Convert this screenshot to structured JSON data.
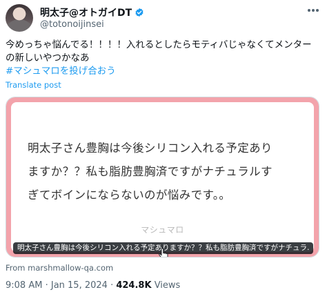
{
  "author": {
    "display_name": "明太子@オトガイDT",
    "handle": "@totonoijinsei"
  },
  "post": {
    "text": "今めっちゃ悩んでる！！！！入れるとしたらモティバじゃなくてメンター",
    "text_line2": "の新しいやつかなあ",
    "hashtag": "#マシュマロを投げ合おう",
    "translate_label": "Translate post"
  },
  "card": {
    "question_line1": "明太子さん豊胸は今後シリコン入れる予定あり",
    "question_line2": "ますか？？私も脂肪豊胸済ですがナチュラルす",
    "question_line3": "ぎてボインにならないのが悩みです。。",
    "brand": "マシュマロ",
    "caption": "明太子さん豊胸は今後シリコン入れる予定ありますか？？私も脂肪豊胸済ですがナチュラ…",
    "source": "From marshmallow-qa.com",
    "frame_color": "#f3a3ab"
  },
  "meta": {
    "time": "9:08 AM",
    "separator": "·",
    "date": "Jan 15, 2024",
    "views_count": "424.8K",
    "views_label": "Views"
  },
  "colors": {
    "link": "#1d9bf0",
    "secondary_text": "#536471",
    "verified_badge": "#1d9bf0"
  },
  "icons": {
    "verified": "verified-badge-icon",
    "more": "more-options-icon"
  }
}
